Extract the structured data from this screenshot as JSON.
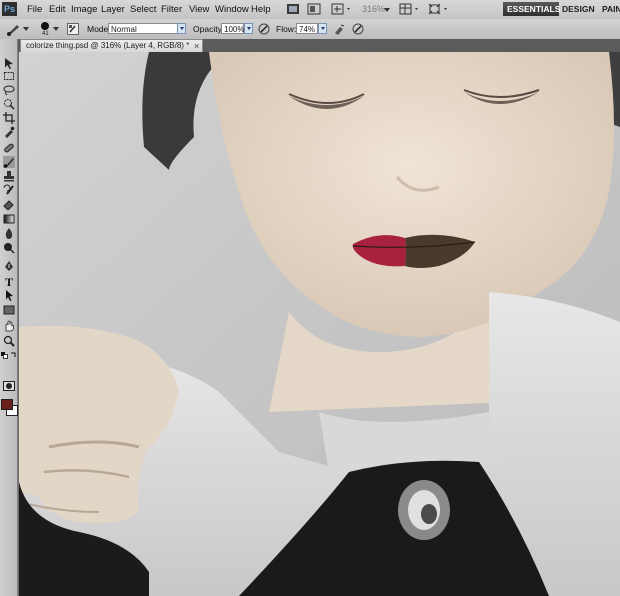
{
  "app": {
    "logo": "Ps",
    "menu": [
      "File",
      "Edit",
      "Image",
      "Layer",
      "Select",
      "Filter",
      "View",
      "Window",
      "Help"
    ],
    "zoom": "316%",
    "workspaces": [
      "ESSENTIALS",
      "DESIGN",
      "PAINT"
    ],
    "active_workspace": "ESSENTIALS"
  },
  "options": {
    "brush_size": "41",
    "mode_label": "Mode:",
    "mode_value": "Normal",
    "opacity_label": "Opacity:",
    "opacity_value": "100%",
    "flow_label": "Flow:",
    "flow_value": "74%"
  },
  "document": {
    "tab_title": "colorize thing.psd @ 316% (Layer 4, RGB/8) *",
    "close_glyph": "×"
  },
  "colors": {
    "foreground": "#6b1f1c",
    "background": "#ffffff",
    "lipstick": "#a8213e"
  },
  "tools": [
    "move-tool",
    "marquee-tool",
    "lasso-tool",
    "quick-selection-tool",
    "crop-tool",
    "eyedropper-tool",
    "healing-brush-tool",
    "brush-tool",
    "clone-stamp-tool",
    "history-brush-tool",
    "eraser-tool",
    "gradient-tool",
    "blur-tool",
    "dodge-tool",
    "pen-tool",
    "type-tool",
    "path-selection-tool",
    "rectangle-tool",
    "hand-tool",
    "zoom-tool",
    "quick-mask-mode",
    "screen-mode"
  ],
  "active_tool": "brush-tool"
}
